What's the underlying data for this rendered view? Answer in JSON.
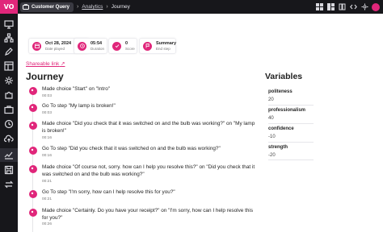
{
  "app": {
    "logo_text": "VO"
  },
  "topbar": {
    "project_label": "Customer Query",
    "breadcrumb": {
      "analytics": "Analytics",
      "current": "Journey"
    }
  },
  "summary": [
    {
      "value": "Oct 28, 2024",
      "label": "Date played",
      "icon": "calendar-icon"
    },
    {
      "value": "05:54",
      "label": "Duration",
      "icon": "clock-icon"
    },
    {
      "value": "0",
      "label": "Score",
      "icon": "check-icon"
    },
    {
      "value": "Summary",
      "label": "End step",
      "icon": "flag-icon"
    }
  ],
  "share_link": "Shareable link",
  "journey": {
    "heading": "Journey",
    "entries": [
      {
        "text": "Made choice \"Start\" on \"Intro\"",
        "time": "00:03"
      },
      {
        "text": "Go To step \"My lamp is broken!\"",
        "time": "00:03"
      },
      {
        "text": "Made choice \"Did you check that it was switched on and the bulb was working?\" on \"My lamp is broken!\"",
        "time": "00:16"
      },
      {
        "text": "Go To step \"Did you check that it was switched on and the bulb was working?\"",
        "time": "00:16"
      },
      {
        "text": "Made choice \"Of course not, sorry. how can I help you resolve this?\" on \"Did you check that it was switched on and the bulb was working?\"",
        "time": "00:21"
      },
      {
        "text": "Go To step \"I'm sorry, how can I help resolve this for you?\"",
        "time": "00:21"
      },
      {
        "text": "Made choice \"Certainly. Do you have your receipt?\" on \"I'm sorry, how can I help resolve this for you?\"",
        "time": "00:26"
      }
    ]
  },
  "variables": {
    "heading": "Variables",
    "items": [
      {
        "name": "politeness",
        "value": "20"
      },
      {
        "name": "professionalism",
        "value": "40"
      },
      {
        "name": "confidence",
        "value": "-10"
      },
      {
        "name": "strength",
        "value": "-20"
      }
    ]
  },
  "colors": {
    "accent": "#e0267a",
    "rail": "#17171b"
  }
}
